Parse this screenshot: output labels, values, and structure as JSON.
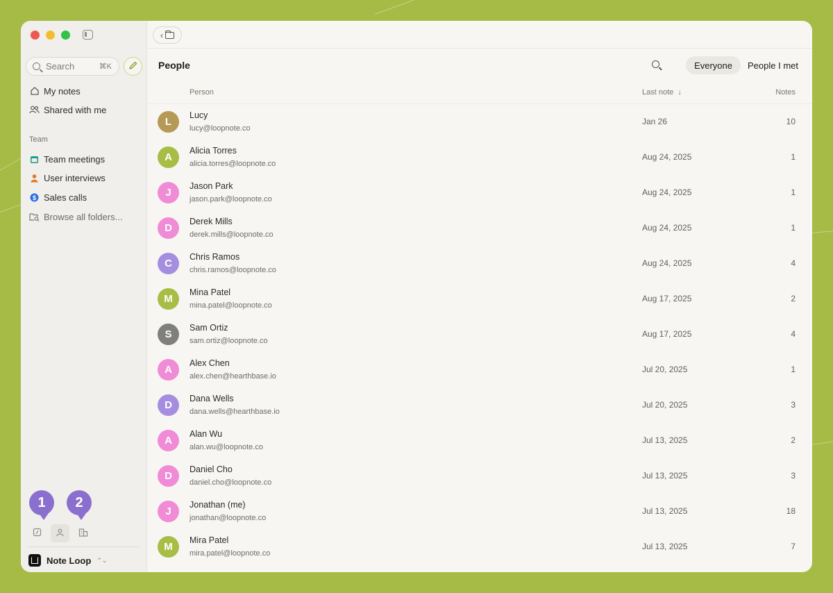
{
  "sidebar": {
    "search_label": "Search",
    "search_shortcut": "⌘K",
    "nav": [
      {
        "label": "My notes",
        "icon": "home-icon"
      },
      {
        "label": "Shared with me",
        "icon": "people-icon"
      }
    ],
    "section_label": "Team",
    "folders": [
      {
        "label": "Team meetings",
        "icon": "calendar-icon",
        "color": "#1a9e8e"
      },
      {
        "label": "User interviews",
        "icon": "person-icon",
        "color": "#e07a2a"
      },
      {
        "label": "Sales calls",
        "icon": "dollar-icon",
        "color": "#2f6fe0"
      },
      {
        "label": "Browse all folders...",
        "icon": "folder-search-icon",
        "color": "#77776f"
      }
    ],
    "badges": [
      "1",
      "2"
    ],
    "workspace_name": "Note Loop"
  },
  "main": {
    "title": "People",
    "filters": [
      "Everyone",
      "People I met"
    ],
    "active_filter": "Everyone",
    "columns": {
      "person": "Person",
      "last_note": "Last note",
      "notes": "Notes"
    },
    "people": [
      {
        "initial": "L",
        "name": "Lucy",
        "email": "lucy@loopnote.co",
        "last_note": "Jan 26",
        "notes": "10",
        "color": "#b49a56"
      },
      {
        "initial": "A",
        "name": "Alicia Torres",
        "email": "alicia.torres@loopnote.co",
        "last_note": "Aug 24, 2025",
        "notes": "1",
        "color": "#a7bd45"
      },
      {
        "initial": "J",
        "name": "Jason Park",
        "email": "jason.park@loopnote.co",
        "last_note": "Aug 24, 2025",
        "notes": "1",
        "color": "#f08bd6"
      },
      {
        "initial": "D",
        "name": "Derek Mills",
        "email": "derek.mills@loopnote.co",
        "last_note": "Aug 24, 2025",
        "notes": "1",
        "color": "#f08bd6"
      },
      {
        "initial": "C",
        "name": "Chris Ramos",
        "email": "chris.ramos@loopnote.co",
        "last_note": "Aug 24, 2025",
        "notes": "4",
        "color": "#a58ee0"
      },
      {
        "initial": "M",
        "name": "Mina Patel",
        "email": "mina.patel@loopnote.co",
        "last_note": "Aug 17, 2025",
        "notes": "2",
        "color": "#a7bd45"
      },
      {
        "initial": "S",
        "name": "Sam Ortiz",
        "email": "sam.ortiz@loopnote.co",
        "last_note": "Aug 17, 2025",
        "notes": "4",
        "color": "#7f7f7b"
      },
      {
        "initial": "A",
        "name": "Alex Chen",
        "email": "alex.chen@hearthbase.io",
        "last_note": "Jul 20, 2025",
        "notes": "1",
        "color": "#f08bd6"
      },
      {
        "initial": "D",
        "name": "Dana Wells",
        "email": "dana.wells@hearthbase.io",
        "last_note": "Jul 20, 2025",
        "notes": "3",
        "color": "#a58ee0"
      },
      {
        "initial": "A",
        "name": "Alan Wu",
        "email": "alan.wu@loopnote.co",
        "last_note": "Jul 13, 2025",
        "notes": "2",
        "color": "#f08bd6"
      },
      {
        "initial": "D",
        "name": "Daniel Cho",
        "email": "daniel.cho@loopnote.co",
        "last_note": "Jul 13, 2025",
        "notes": "3",
        "color": "#f08bd6"
      },
      {
        "initial": "J",
        "name": "Jonathan (me)",
        "email": "jonathan@loopnote.co",
        "last_note": "Jul 13, 2025",
        "notes": "18",
        "color": "#f08bd6"
      },
      {
        "initial": "M",
        "name": "Mira Patel",
        "email": "mira.patel@loopnote.co",
        "last_note": "Jul 13, 2025",
        "notes": "7",
        "color": "#a7bd45"
      }
    ]
  }
}
